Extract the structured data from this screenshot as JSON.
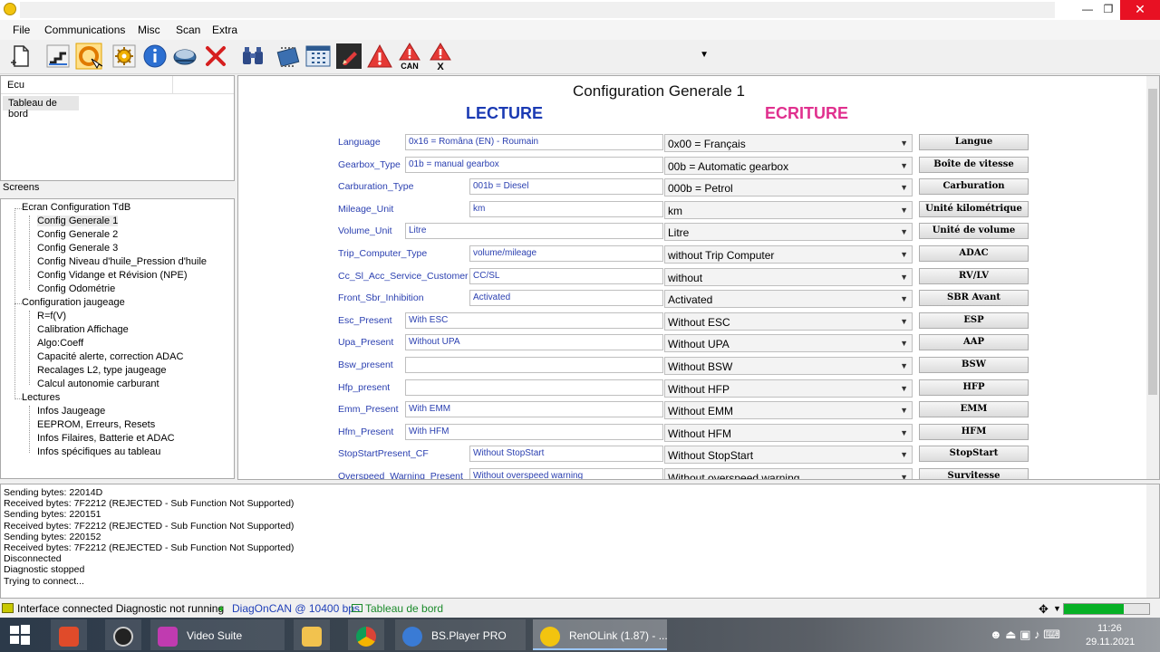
{
  "window": {
    "minimize_glyph": "—",
    "maximize_glyph": "❐",
    "close_glyph": "✕"
  },
  "menu": [
    "File",
    "Communications",
    "Misc",
    "Scan",
    "Extra"
  ],
  "toolbar": {
    "icons": [
      "new-document-icon",
      "connection-icon",
      "connect-ring-icon",
      "settings-gear-icon",
      "info-icon",
      "scanner-icon",
      "close-x-icon",
      "binoculars-icon",
      "ecu-chip-icon",
      "grid-window-icon",
      "pen-edit-icon",
      "warning-icon",
      "can-warning-icon",
      "clear-warning-icon"
    ],
    "can_label": "CAN",
    "clear_label": "X"
  },
  "ecu_panel": {
    "header": "Ecu",
    "selected": "Tableau de bord"
  },
  "screens_panel": {
    "label": "Screens",
    "groups": [
      {
        "title": "Ecran Configuration TdB",
        "items": [
          "Config Generale 1",
          "Config Generale 2",
          "Config Generale 3",
          "Config Niveau d'huile_Pression d'huile",
          "Config Vidange et Révision (NPE)",
          "Config Odométrie"
        ]
      },
      {
        "title": "Configuration jaugeage",
        "items": [
          "R=f(V)",
          "Calibration Affichage",
          "Algo:Coeff",
          "Capacité alerte, correction ADAC",
          "Recalages L2, type jaugeage",
          "Calcul autonomie carburant"
        ]
      },
      {
        "title": "Lectures",
        "items": [
          "Infos Jaugeage",
          "EEPROM, Erreurs, Resets",
          "Infos Filaires, Batterie et ADAC",
          "Infos spécifiques au tableau"
        ]
      }
    ]
  },
  "form": {
    "title": "Configuration Generale 1",
    "lecture": "LECTURE",
    "ecriture": "ECRITURE",
    "rows": [
      {
        "label": "Language",
        "read": "0x16 = Româna (EN) - Roumain",
        "write": "0x00 = Français",
        "button": "Langue",
        "wide": true
      },
      {
        "label": "Gearbox_Type",
        "read": "01b = manual gearbox",
        "write": "00b = Automatic gearbox",
        "button": "Boîte de vitesse",
        "wide": true
      },
      {
        "label": "Carburation_Type",
        "read": "001b = Diesel",
        "write": "000b = Petrol",
        "button": "Carburation",
        "wide": false
      },
      {
        "label": "Mileage_Unit",
        "read": "km",
        "write": "km",
        "button": "Unité kilométrique",
        "wide": false
      },
      {
        "label": "Volume_Unit",
        "read": "Litre",
        "write": "Litre",
        "button": "Unité de volume",
        "wide": true
      },
      {
        "label": "Trip_Computer_Type",
        "read": "volume/mileage",
        "write": "without Trip Computer",
        "button": "ADAC",
        "wide": false
      },
      {
        "label": "Cc_Sl_Acc_Service_Customer",
        "read": "CC/SL",
        "write": "without",
        "button": "RV/LV",
        "wide": false
      },
      {
        "label": "Front_Sbr_Inhibition",
        "read": "Activated",
        "write": "Activated",
        "button": "SBR Avant",
        "wide": false
      },
      {
        "label": "Esc_Present",
        "read": "With ESC",
        "write": "Without ESC",
        "button": "ESP",
        "wide": true
      },
      {
        "label": "Upa_Present",
        "read": "Without UPA",
        "write": "Without UPA",
        "button": "AAP",
        "wide": true
      },
      {
        "label": "Bsw_present",
        "read": "",
        "write": "Without BSW",
        "button": "BSW",
        "wide": true
      },
      {
        "label": "Hfp_present",
        "read": "",
        "write": "Without HFP",
        "button": "HFP",
        "wide": true
      },
      {
        "label": "Emm_Present",
        "read": "With EMM",
        "write": "Without EMM",
        "button": "EMM",
        "wide": true
      },
      {
        "label": "Hfm_Present",
        "read": "With HFM",
        "write": "Without HFM",
        "button": "HFM",
        "wide": true
      },
      {
        "label": "StopStartPresent_CF",
        "read": "Without StopStart",
        "write": "Without StopStart",
        "button": "StopStart",
        "wide": false
      },
      {
        "label": "Overspeed_Warning_Present",
        "read": "Without overspeed warning",
        "write": "Without overspeed warning",
        "button": "Survitesse",
        "wide": false
      }
    ]
  },
  "log": [
    "Sending bytes: 22014D",
    "Received bytes: 7F2212 (REJECTED - Sub Function Not Supported)",
    "Sending bytes: 220151",
    "Received bytes: 7F2212 (REJECTED - Sub Function Not Supported)",
    "Sending bytes: 220152",
    "Received bytes: 7F2212 (REJECTED - Sub Function Not Supported)",
    "Disconnected",
    "Diagnostic stopped",
    "Trying to connect..."
  ],
  "status": {
    "interface": "Interface connected Diagnostic not running",
    "protocol": "DiagOnCAN @ 10400 bps",
    "ecu": "Tableau de bord",
    "progress": 0.7,
    "colors": {
      "protocol": "#1f3fb8",
      "ecu": "#1a8a2a",
      "progress": "#06b025"
    }
  },
  "taskbar": {
    "apps": [
      {
        "label": "",
        "icon": "power-icon"
      },
      {
        "label": "",
        "icon": "camera-icon"
      },
      {
        "label": "Video Suite",
        "icon": "video-suite-icon"
      },
      {
        "label": "",
        "icon": "folder-icon"
      },
      {
        "label": "",
        "icon": "chrome-icon"
      },
      {
        "label": "BS.Player PRO",
        "icon": "bsplayer-icon"
      },
      {
        "label": "RenOLink (1.87) - ...",
        "icon": "renolink-icon"
      }
    ],
    "time": "11:26",
    "date": "29.11.2021"
  }
}
